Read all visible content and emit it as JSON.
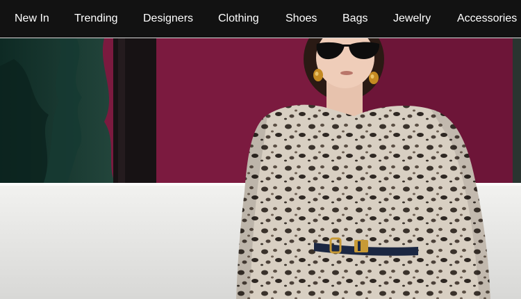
{
  "nav": {
    "items": [
      {
        "label": "New In"
      },
      {
        "label": "Trending"
      },
      {
        "label": "Designers"
      },
      {
        "label": "Clothing"
      },
      {
        "label": "Shoes"
      },
      {
        "label": "Bags"
      },
      {
        "label": "Jewelry"
      },
      {
        "label": "Accessories"
      }
    ]
  },
  "colors": {
    "nav_background": "#121212",
    "nav_text": "#ffffff",
    "backdrop": "#7b1a3f",
    "bench": "#e6e6e4"
  }
}
